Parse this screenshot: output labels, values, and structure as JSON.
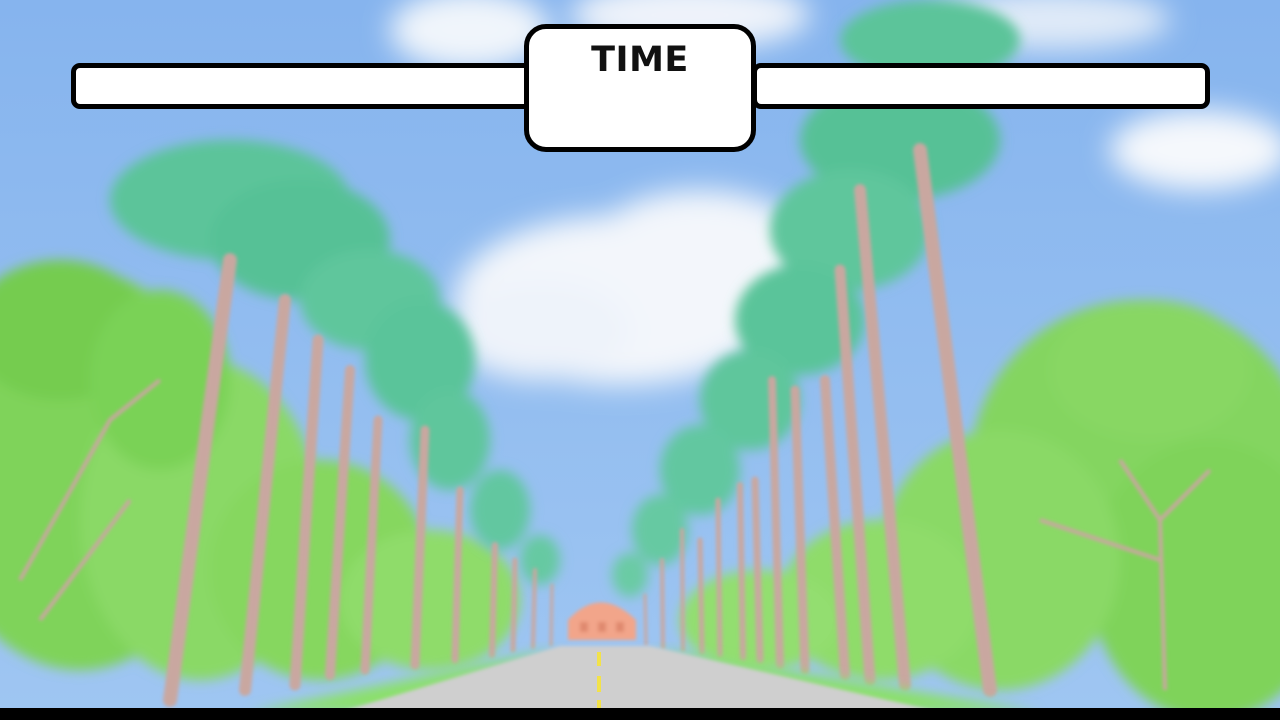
{
  "hud": {
    "time_label": "TIME",
    "left_bar_value": "",
    "right_bar_value": ""
  },
  "scene": {
    "description_icon": "palm-avenue-background"
  },
  "colors": {
    "sky": "#8ab8ef",
    "palm_leaf": "#5cc49a",
    "trunk": "#c9a7a0",
    "bush": "#7fd35a",
    "road": "#cfcfcf",
    "lane_mark": "#f2e24a"
  }
}
